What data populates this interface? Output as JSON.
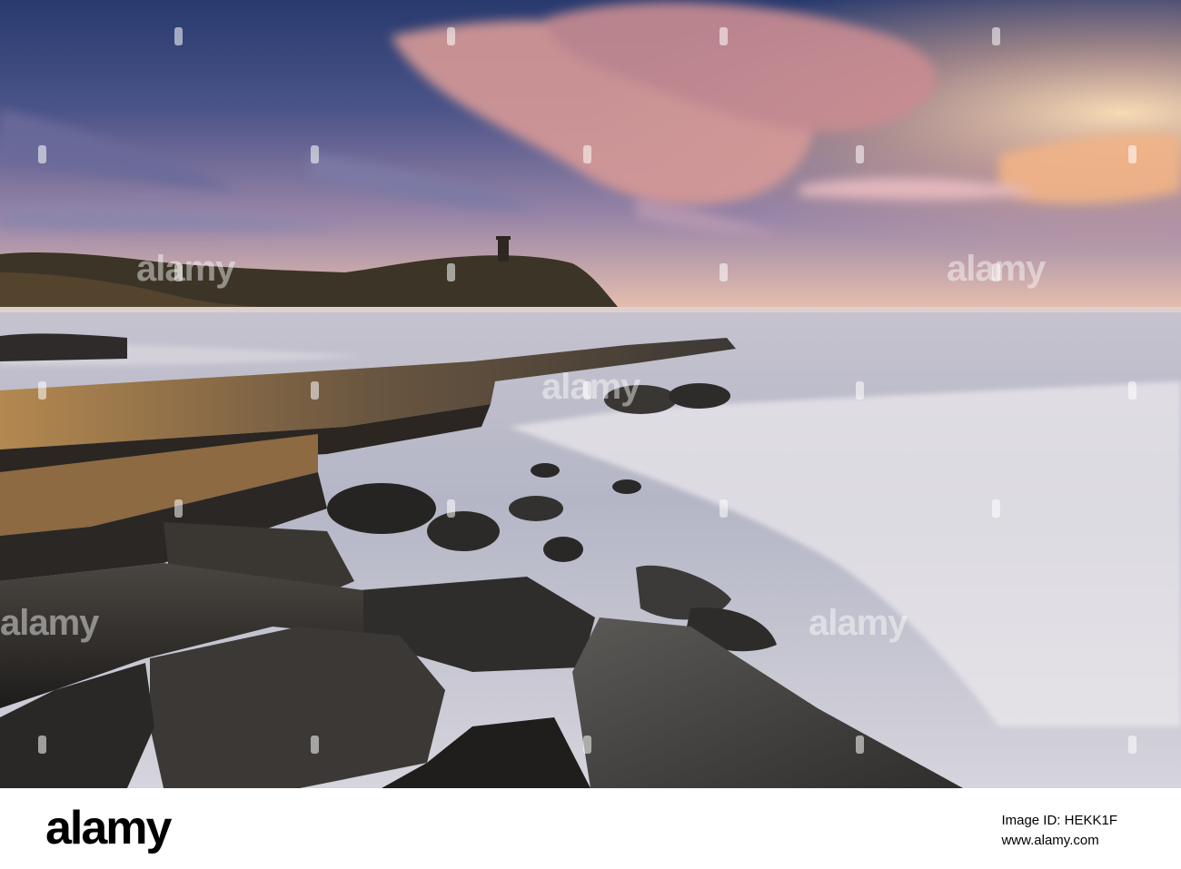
{
  "photo": {
    "subject": "Rocky ledges at the shore of a bay at sunset, with a headland and tower on the horizon",
    "colors": {
      "sky_top": "#2e3f72",
      "sky_mid": "#7a6f9e",
      "sky_glow": "#f6c39d",
      "cloud_pink": "#e9a79a",
      "sea": "#b6b9c8",
      "rock_dark": "#2a2826",
      "rock_warm": "#9a7445"
    }
  },
  "watermark": {
    "text": "alamy"
  },
  "footer": {
    "logo_text": "alamy",
    "image_id": "Image ID: HEKK1F",
    "site_url": "www.alamy.com"
  }
}
